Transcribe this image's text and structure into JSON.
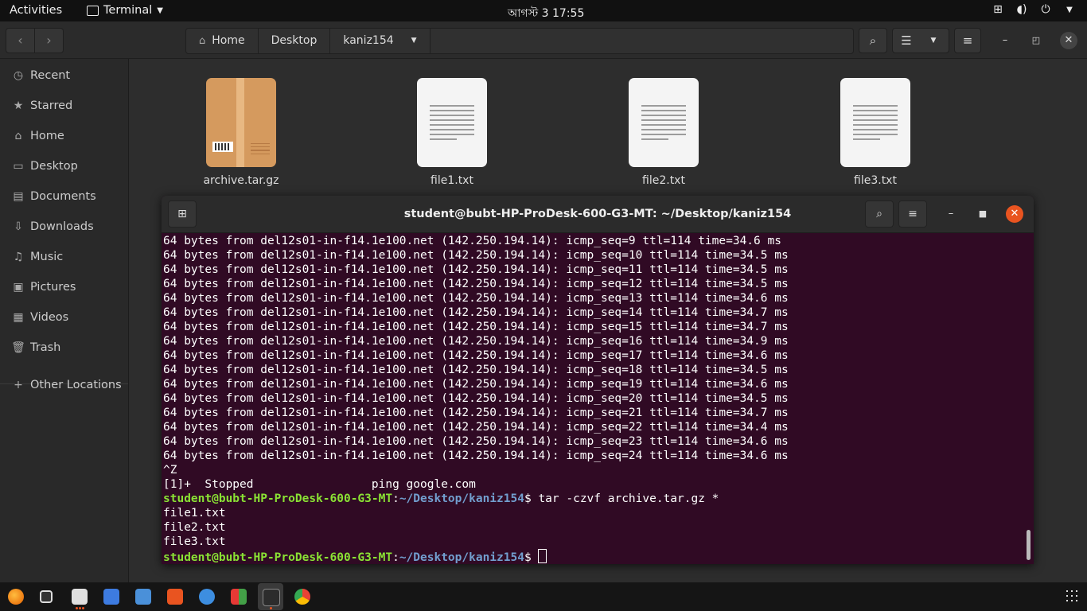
{
  "topbar": {
    "activities": "Activities",
    "app_name": "Terminal",
    "clock": "আগস্ট 3  17:55"
  },
  "file_manager": {
    "path": [
      "Home",
      "Desktop",
      "kaniz154"
    ],
    "sidebar": [
      {
        "label": "Recent",
        "icon": "clock-icon"
      },
      {
        "label": "Starred",
        "icon": "star-icon"
      },
      {
        "label": "Home",
        "icon": "home-icon"
      },
      {
        "label": "Desktop",
        "icon": "desktop-icon"
      },
      {
        "label": "Documents",
        "icon": "documents-icon"
      },
      {
        "label": "Downloads",
        "icon": "download-icon"
      },
      {
        "label": "Music",
        "icon": "music-icon"
      },
      {
        "label": "Pictures",
        "icon": "pictures-icon"
      },
      {
        "label": "Videos",
        "icon": "videos-icon"
      },
      {
        "label": "Trash",
        "icon": "trash-icon"
      },
      {
        "label": "Other Locations",
        "icon": "plus-icon"
      }
    ],
    "files": [
      "archive.tar.gz",
      "file1.txt",
      "file2.txt",
      "file3.txt"
    ]
  },
  "terminal": {
    "title": "student@bubt-HP-ProDesk-600-G3-MT: ~/Desktop/kaniz154",
    "ping_lines": [
      "64 bytes from del12s01-in-f14.1e100.net (142.250.194.14): icmp_seq=9 ttl=114 time=34.6 ms",
      "64 bytes from del12s01-in-f14.1e100.net (142.250.194.14): icmp_seq=10 ttl=114 time=34.5 ms",
      "64 bytes from del12s01-in-f14.1e100.net (142.250.194.14): icmp_seq=11 ttl=114 time=34.5 ms",
      "64 bytes from del12s01-in-f14.1e100.net (142.250.194.14): icmp_seq=12 ttl=114 time=34.5 ms",
      "64 bytes from del12s01-in-f14.1e100.net (142.250.194.14): icmp_seq=13 ttl=114 time=34.6 ms",
      "64 bytes from del12s01-in-f14.1e100.net (142.250.194.14): icmp_seq=14 ttl=114 time=34.7 ms",
      "64 bytes from del12s01-in-f14.1e100.net (142.250.194.14): icmp_seq=15 ttl=114 time=34.7 ms",
      "64 bytes from del12s01-in-f14.1e100.net (142.250.194.14): icmp_seq=16 ttl=114 time=34.9 ms",
      "64 bytes from del12s01-in-f14.1e100.net (142.250.194.14): icmp_seq=17 ttl=114 time=34.6 ms",
      "64 bytes from del12s01-in-f14.1e100.net (142.250.194.14): icmp_seq=18 ttl=114 time=34.5 ms",
      "64 bytes from del12s01-in-f14.1e100.net (142.250.194.14): icmp_seq=19 ttl=114 time=34.6 ms",
      "64 bytes from del12s01-in-f14.1e100.net (142.250.194.14): icmp_seq=20 ttl=114 time=34.5 ms",
      "64 bytes from del12s01-in-f14.1e100.net (142.250.194.14): icmp_seq=21 ttl=114 time=34.7 ms",
      "64 bytes from del12s01-in-f14.1e100.net (142.250.194.14): icmp_seq=22 ttl=114 time=34.4 ms",
      "64 bytes from del12s01-in-f14.1e100.net (142.250.194.14): icmp_seq=23 ttl=114 time=34.6 ms",
      "64 bytes from del12s01-in-f14.1e100.net (142.250.194.14): icmp_seq=24 ttl=114 time=34.6 ms"
    ],
    "ctrl_z": "^Z",
    "stopped": "[1]+  Stopped                 ping google.com",
    "prompt_user": "student@bubt-HP-ProDesk-600-G3-MT",
    "prompt_sep": ":",
    "prompt_path": "~/Desktop/kaniz154",
    "prompt_end": "$ ",
    "command": "tar -czvf archive.tar.gz *",
    "output": [
      "file1.txt",
      "file2.txt",
      "file3.txt"
    ]
  },
  "colors": {
    "terminal_bg": "#300a24",
    "prompt_user": "#8ae234",
    "prompt_path": "#729fcf",
    "accent": "#e95420"
  }
}
